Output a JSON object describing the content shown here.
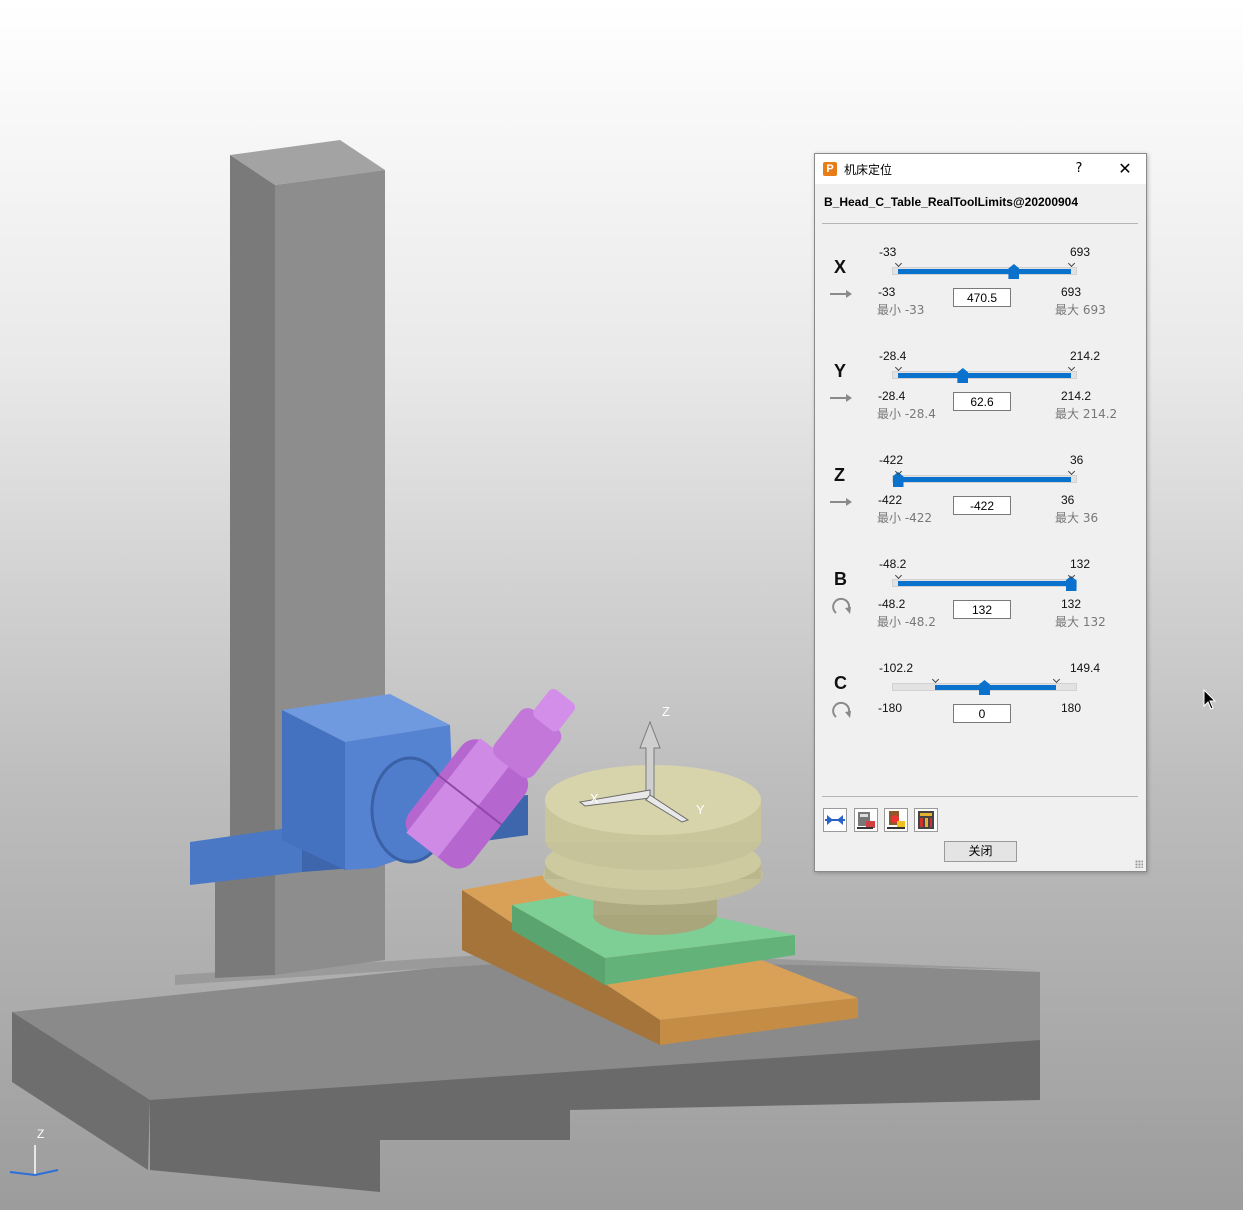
{
  "dialog": {
    "title": "机床定位",
    "app_icon": "P",
    "help_label": "?",
    "close_icon": "✕",
    "machine_name": "B_Head_C_Table_RealToolLimits@20200904",
    "close_button_label": "关闭",
    "accent_color": "#0a72cc"
  },
  "axes": [
    {
      "name": "X",
      "kind": "linear",
      "icon": "linear-arrow-icon",
      "limit_top_min": "-33",
      "limit_top_max": "693",
      "range_min": "-33",
      "range_max": "693",
      "min_label": "最小 -33",
      "max_label": "最大 693",
      "value": "470.5",
      "slider_fraction": 0.67,
      "fill_from": 0.0,
      "fill_to": 1.0
    },
    {
      "name": "Y",
      "kind": "linear",
      "icon": "linear-arrow-icon",
      "limit_top_min": "-28.4",
      "limit_top_max": "214.2",
      "range_min": "-28.4",
      "range_max": "214.2",
      "min_label": "最小 -28.4",
      "max_label": "最大 214.2",
      "value": "62.6",
      "slider_fraction": 0.375,
      "fill_from": 0.0,
      "fill_to": 1.0
    },
    {
      "name": "Z",
      "kind": "linear",
      "icon": "linear-arrow-icon",
      "limit_top_min": "-422",
      "limit_top_max": "36",
      "range_min": "-422",
      "range_max": "36",
      "min_label": "最小 -422",
      "max_label": "最大 36",
      "value": "-422",
      "slider_fraction": 0.0,
      "fill_from": 0.0,
      "fill_to": 1.0
    },
    {
      "name": "B",
      "kind": "rotary",
      "icon": "rotary-arrow-icon",
      "limit_top_min": "-48.2",
      "limit_top_max": "132",
      "range_min": "-48.2",
      "range_max": "132",
      "min_label": "最小 -48.2",
      "max_label": "最大 132",
      "value": "132",
      "slider_fraction": 1.0,
      "fill_from": 0.0,
      "fill_to": 1.0
    },
    {
      "name": "C",
      "kind": "rotary",
      "icon": "rotary-arrow-icon",
      "limit_top_min": "-102.2",
      "limit_top_max": "149.4",
      "range_min": "-180",
      "range_max": "180",
      "min_label": "",
      "max_label": "",
      "value": "0",
      "slider_fraction": 0.5,
      "fill_from": 0.216,
      "fill_to": 0.915
    }
  ],
  "toolbar_icons": [
    "align-tool-icon",
    "machine-settings-icon",
    "tool-change-icon",
    "machine-table-icon"
  ],
  "viewport": {
    "workplane_labels": {
      "x": "X",
      "y": "Y",
      "z": "Z"
    },
    "corner_triad_label": "Z"
  }
}
